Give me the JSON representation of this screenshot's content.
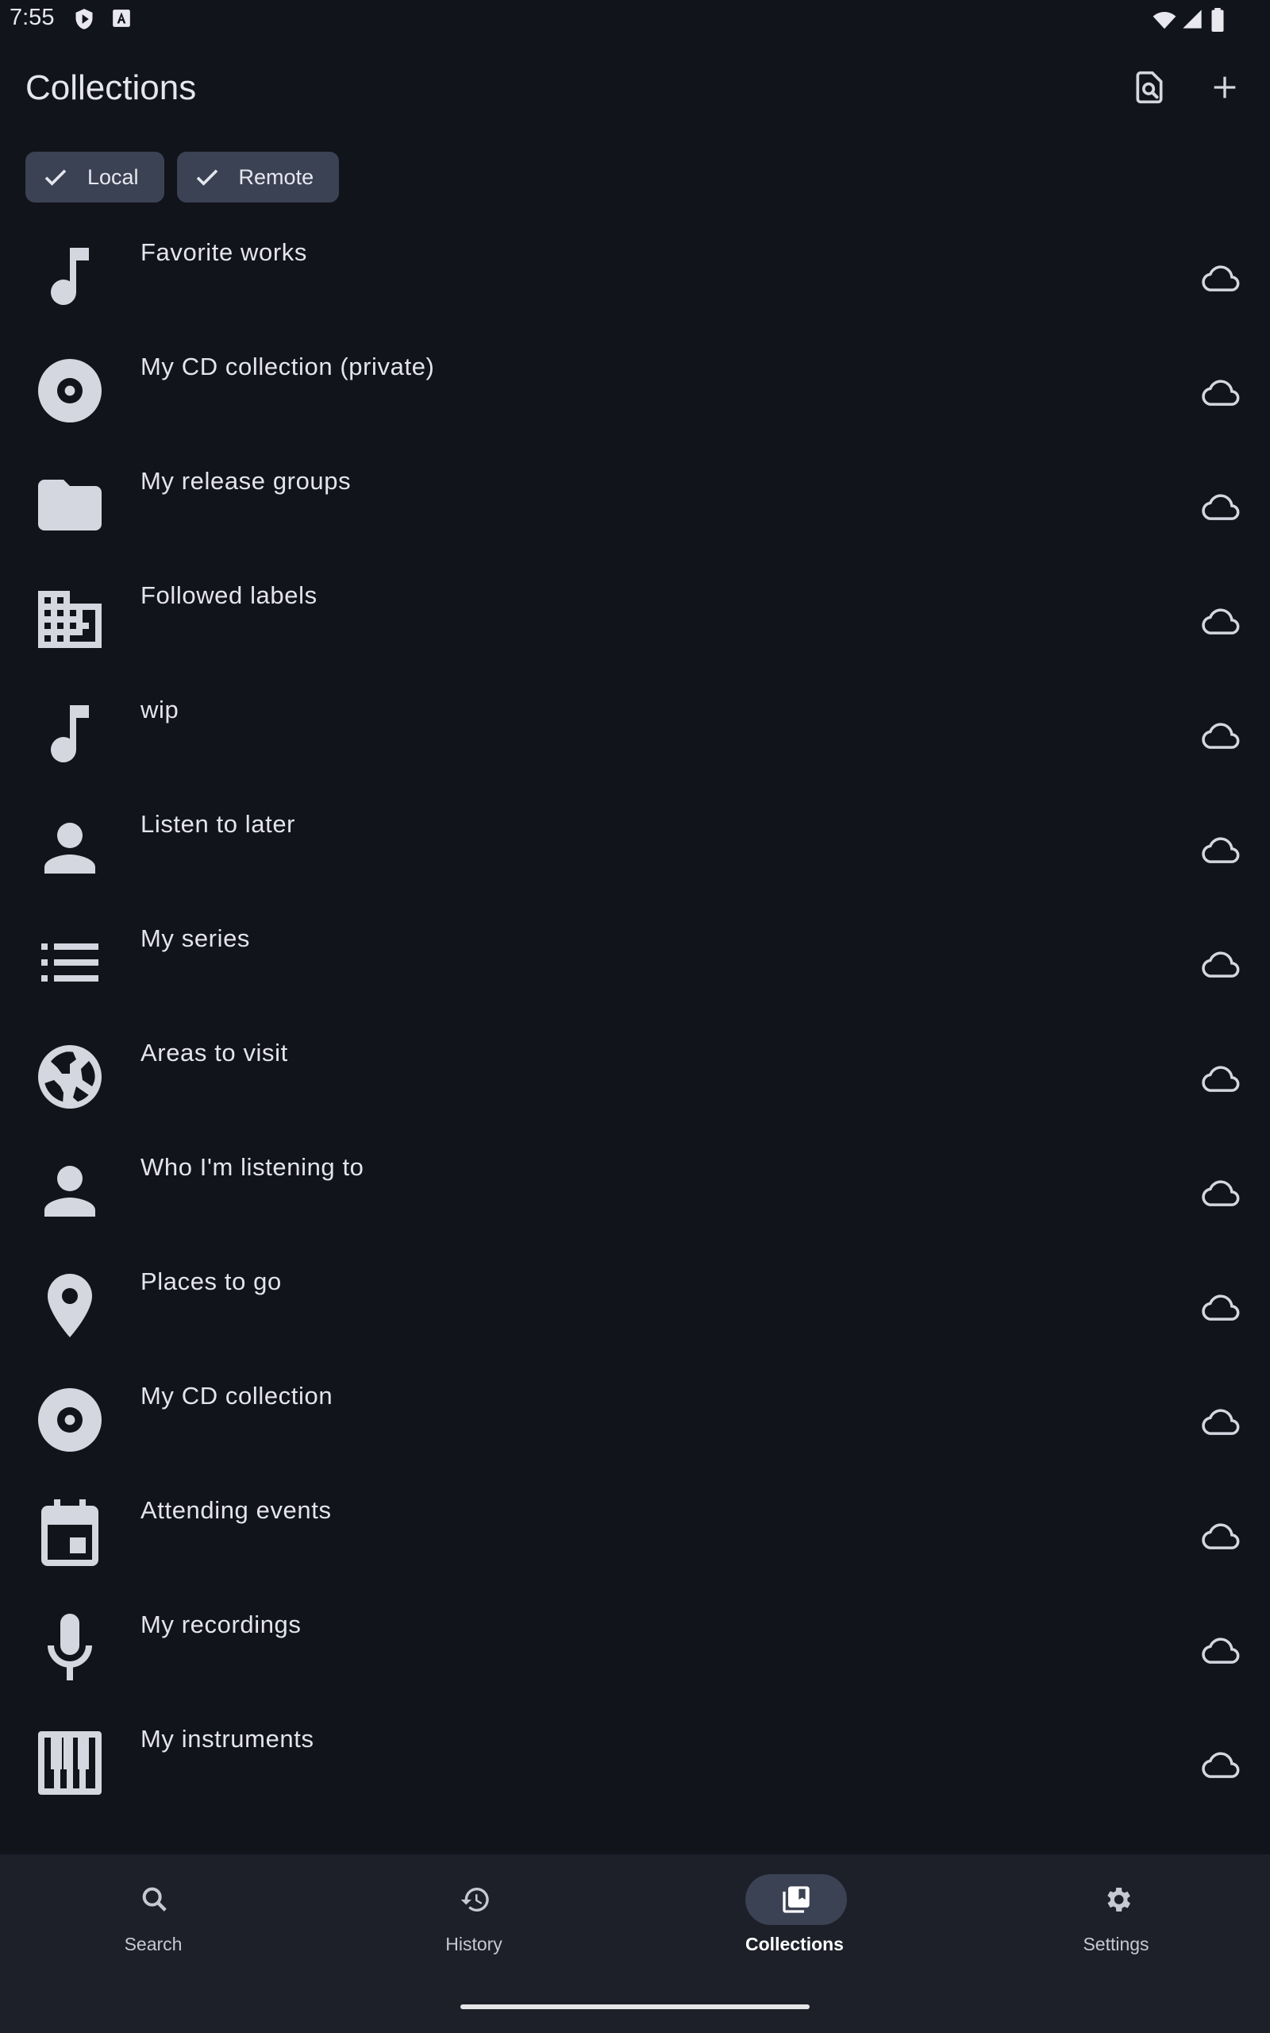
{
  "status_bar": {
    "time": "7:55",
    "icons": [
      "shield-notification-icon",
      "a-notification-icon",
      "wifi-icon",
      "signal-icon",
      "battery-icon"
    ]
  },
  "app_bar": {
    "title": "Collections",
    "actions": [
      "search-document-icon",
      "add-icon"
    ]
  },
  "filters": [
    {
      "label": "Local",
      "selected": true
    },
    {
      "label": "Remote",
      "selected": true
    }
  ],
  "collections": [
    {
      "label": "Favorite works",
      "icon": "music-note-icon"
    },
    {
      "label": "My CD collection (private)",
      "icon": "disc-icon"
    },
    {
      "label": "My release groups",
      "icon": "folder-icon"
    },
    {
      "label": "Followed labels",
      "icon": "label-building-icon"
    },
    {
      "label": "wip",
      "icon": "music-note-icon"
    },
    {
      "label": "Listen to later",
      "icon": "person-icon"
    },
    {
      "label": "My series",
      "icon": "list-icon"
    },
    {
      "label": "Areas to visit",
      "icon": "globe-icon"
    },
    {
      "label": "Who I'm listening to",
      "icon": "person-icon"
    },
    {
      "label": "Places to go",
      "icon": "location-pin-icon"
    },
    {
      "label": "My CD collection",
      "icon": "disc-icon"
    },
    {
      "label": "Attending events",
      "icon": "calendar-event-icon"
    },
    {
      "label": "My recordings",
      "icon": "microphone-icon"
    },
    {
      "label": "My instruments",
      "icon": "piano-icon"
    }
  ],
  "row_trailing_icon": "cloud-icon",
  "bottom_nav": [
    {
      "label": "Search",
      "icon": "search-icon",
      "active": false
    },
    {
      "label": "History",
      "icon": "history-icon",
      "active": false
    },
    {
      "label": "Collections",
      "icon": "collections-icon",
      "active": true
    },
    {
      "label": "Settings",
      "icon": "settings-icon",
      "active": false
    }
  ],
  "colors": {
    "background": "#12141b",
    "surface": "#1d2029",
    "chip": "#3b4253",
    "icon": "#d4d6e0",
    "text": "#e4e4ea"
  }
}
